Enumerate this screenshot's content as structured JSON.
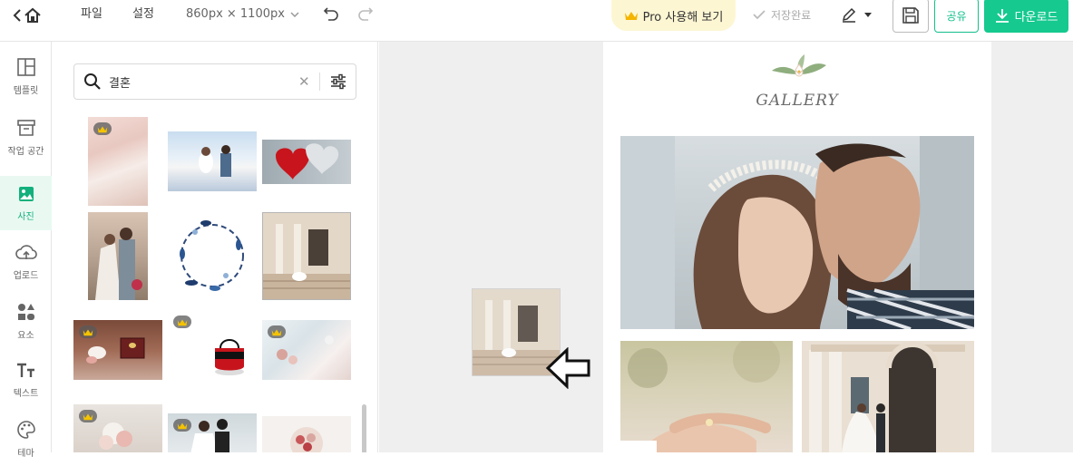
{
  "topbar": {
    "menu_file": "파일",
    "menu_settings": "설정",
    "canvas_size": "860px × 1100px",
    "pro_label": "Pro 사용해 보기",
    "saved_label": "저장완료",
    "share_label": "공유",
    "download_label": "다운로드"
  },
  "rail": {
    "items": [
      {
        "label": "템플릿",
        "icon": "template-icon"
      },
      {
        "label": "작업 공간",
        "icon": "archive-icon"
      },
      {
        "label": "사진",
        "icon": "photo-icon"
      },
      {
        "label": "업로드",
        "icon": "cloud-upload-icon"
      },
      {
        "label": "요소",
        "icon": "elements-icon"
      },
      {
        "label": "텍스트",
        "icon": "text-icon"
      },
      {
        "label": "테마",
        "icon": "palette-icon"
      }
    ],
    "active": "사진"
  },
  "search": {
    "value": "결혼",
    "placeholder": ""
  },
  "canvas": {
    "gallery_title": "GALLERY"
  },
  "colors": {
    "accent": "#13c08c",
    "pro_bg": "#fdf6d3",
    "active_bg": "#e9f9f2",
    "workspace_bg": "#efefef"
  }
}
